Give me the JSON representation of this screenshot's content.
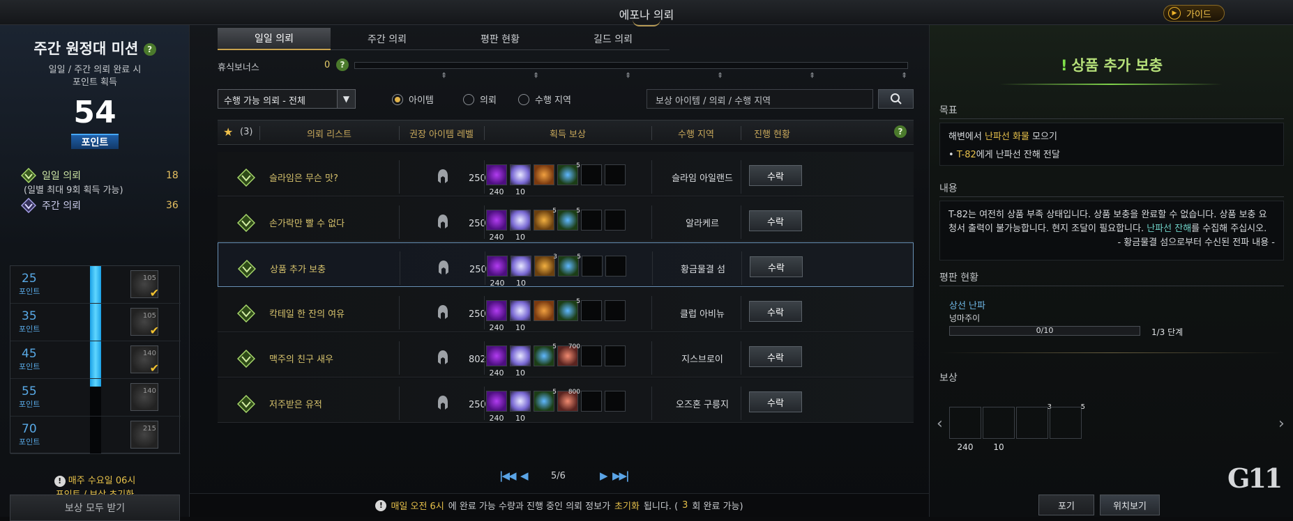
{
  "window": {
    "title": "에포나 의뢰",
    "guide_label": "가이드"
  },
  "left": {
    "title": "주간 원정대 미션",
    "subtitle_line1": "일일 / 주간 의뢰 완료 시",
    "subtitle_line2": "포인트 획득",
    "points": "54",
    "points_label": "포인트",
    "daily_label": "일일 의뢰",
    "daily_value": "18",
    "daily_note": "(일별 최대 9회 획득 가능)",
    "weekly_label": "주간 의뢰",
    "weekly_value": "36",
    "tiers": [
      {
        "points": "25",
        "unit": "포인트",
        "qty": "105",
        "claimed": true
      },
      {
        "points": "35",
        "unit": "포인트",
        "qty": "105",
        "claimed": true
      },
      {
        "points": "45",
        "unit": "포인트",
        "qty": "140",
        "claimed": true
      },
      {
        "points": "55",
        "unit": "포인트",
        "qty": "140",
        "claimed": false
      },
      {
        "points": "70",
        "unit": "포인트",
        "qty": "215",
        "claimed": false
      }
    ],
    "progress_fraction": 0.64,
    "notice_line1": "매주 수요일 06시",
    "notice_line2": "포인트 / 보상 초기화",
    "claim_all_label": "보상 모두 받기"
  },
  "tabs": [
    {
      "label": "일일 의뢰",
      "active": true
    },
    {
      "label": "주간 의뢰",
      "active": false
    },
    {
      "label": "평판 현황",
      "active": false
    },
    {
      "label": "길드 의뢰",
      "active": false
    }
  ],
  "rest_bonus": {
    "label": "휴식보너스",
    "value": "0"
  },
  "filters": {
    "select_value": "수행 가능 의뢰 - 전체",
    "radios": [
      {
        "label": "아이템",
        "checked": true
      },
      {
        "label": "의뢰",
        "checked": false
      },
      {
        "label": "수행 지역",
        "checked": false
      }
    ],
    "search_placeholder": "보상 아이템 / 의뢰 / 수행 지역"
  },
  "table": {
    "fav_count": "(3)",
    "headers": [
      "의뢰 리스트",
      "권장 아이템 레벨",
      "획득 보상",
      "수행 지역",
      "진행 현황"
    ],
    "rows": [
      {
        "name": "슬라임은 무슨 맛?",
        "level": "250 이상",
        "area": "슬라임 아일랜드",
        "action": "수락",
        "selected": false,
        "rewards": [
          {
            "type": "purple",
            "qty": "240",
            "cnt": ""
          },
          {
            "type": "dia",
            "qty": "10",
            "cnt": ""
          },
          {
            "type": "orange",
            "qty": "",
            "cnt": ""
          },
          {
            "type": "vial",
            "qty": "",
            "cnt": "5"
          }
        ]
      },
      {
        "name": "손가락만 빨 수 없다",
        "level": "250 이상",
        "area": "알라케르",
        "action": "수락",
        "selected": false,
        "rewards": [
          {
            "type": "purple",
            "qty": "240",
            "cnt": ""
          },
          {
            "type": "dia",
            "qty": "10",
            "cnt": ""
          },
          {
            "type": "gold",
            "qty": "",
            "cnt": "5"
          },
          {
            "type": "vial",
            "qty": "",
            "cnt": "5"
          }
        ]
      },
      {
        "name": "상품 추가 보충",
        "level": "250 이상",
        "area": "황금물결 섬",
        "action": "수락",
        "selected": true,
        "rewards": [
          {
            "type": "purple",
            "qty": "240",
            "cnt": ""
          },
          {
            "type": "dia",
            "qty": "10",
            "cnt": ""
          },
          {
            "type": "gold",
            "qty": "",
            "cnt": "3"
          },
          {
            "type": "vial",
            "qty": "",
            "cnt": "5"
          }
        ]
      },
      {
        "name": "칵테일 한 잔의 여유",
        "level": "250 이상",
        "area": "클럽 아비뉴",
        "action": "수락",
        "selected": false,
        "rewards": [
          {
            "type": "purple",
            "qty": "240",
            "cnt": ""
          },
          {
            "type": "dia",
            "qty": "10",
            "cnt": ""
          },
          {
            "type": "orange",
            "qty": "",
            "cnt": ""
          },
          {
            "type": "vial",
            "qty": "",
            "cnt": "5"
          }
        ]
      },
      {
        "name": "맥주의 친구 새우",
        "level": "802 이상",
        "area": "지스브로이",
        "action": "수락",
        "selected": false,
        "rewards": [
          {
            "type": "purple",
            "qty": "240",
            "cnt": ""
          },
          {
            "type": "dia",
            "qty": "10",
            "cnt": ""
          },
          {
            "type": "vial",
            "qty": "",
            "cnt": "5"
          },
          {
            "type": "meat",
            "qty": "",
            "cnt": "700"
          }
        ]
      },
      {
        "name": "저주받은 유적",
        "level": "250 이상",
        "area": "오즈혼 구릉지",
        "action": "수락",
        "selected": false,
        "rewards": [
          {
            "type": "purple",
            "qty": "240",
            "cnt": ""
          },
          {
            "type": "dia",
            "qty": "10",
            "cnt": ""
          },
          {
            "type": "vial",
            "qty": "",
            "cnt": "5"
          },
          {
            "type": "meat",
            "qty": "",
            "cnt": "800"
          }
        ]
      }
    ]
  },
  "pager": {
    "text": "5/6"
  },
  "footer": {
    "pre": "매일 오전 6시",
    "mid": "에 완료 가능 수량과 진행 중인 의뢰 정보가 ",
    "reset": "초기화",
    "post": "됩니다. (",
    "count": "3",
    "end": "회 완료 가능)"
  },
  "detail": {
    "title": "상품 추가 보충",
    "goal_label": "목표",
    "goal_main_pre": "해변에서 ",
    "goal_main_hl": "난파선 화물",
    "goal_main_post": " 모으기",
    "goal_sub_hl": "T-82",
    "goal_sub_post": "에게 난파선 잔해 전달",
    "content_label": "내용",
    "content_text": "T-82는 여전히 상품 부족 상태입니다. 상품 보충을 완료할 수 없습니다. 상품 보충 요청서 출력이 불가능합니다. 현지 조달이 필요합니다. ",
    "content_hl": "난파선 잔해",
    "content_post": "를 수집해 주십시오.",
    "content_sign": "- 황금물결 섬으로부터 수신된 전파 내용 -",
    "rep_label": "평판 현황",
    "rep_name": "상선 난파",
    "rep_sub": "넝마주이",
    "rep_bar": "0/10",
    "rep_progress": 0,
    "rep_step": "1/3 단계",
    "reward_label": "보상",
    "rewards": [
      {
        "type": "purple",
        "qty": "240",
        "cnt": ""
      },
      {
        "type": "dia",
        "qty": "10",
        "cnt": ""
      },
      {
        "type": "gold",
        "qty": "",
        "cnt": "3"
      },
      {
        "type": "vial",
        "qty": "",
        "cnt": "5"
      }
    ],
    "abandon_label": "포기",
    "locate_label": "위치보기"
  },
  "watermark": "G11",
  "colors": {
    "accent_gold": "#e6c04a",
    "quest_green": "#b6e07a",
    "link_blue": "#5aa4e6"
  }
}
